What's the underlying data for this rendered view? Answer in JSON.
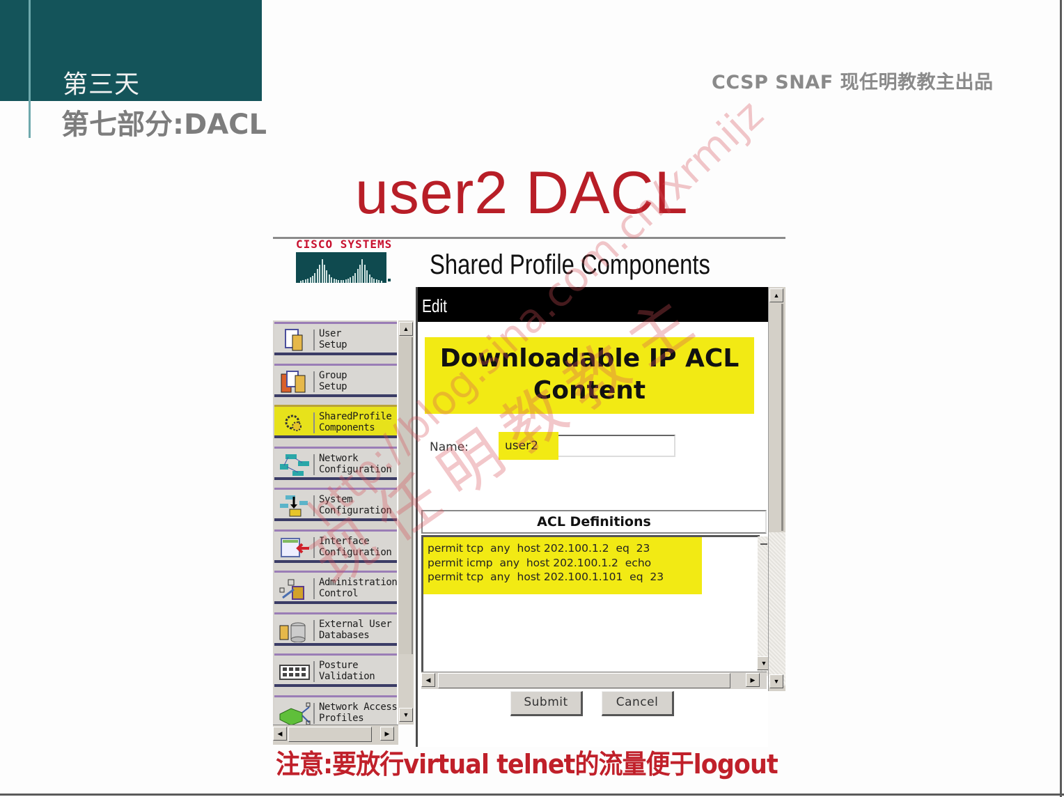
{
  "slide": {
    "day_label": "第三天",
    "part_label": "第七部分:DACL",
    "brand": "CCSP SNAF  现任明教教主出品",
    "title": "user2 DACL",
    "note": "注意:要放行virtual telnet的流量便于logout",
    "colors": {
      "teal": "#14545a",
      "title_red": "#b81e27",
      "highlight_yellow": "#f2ea14"
    }
  },
  "acs": {
    "vendor_text": "CISCO SYSTEMS",
    "page_title": "Shared Profile Components",
    "nav": {
      "items": [
        {
          "label": "User\nSetup",
          "icon": "user-setup-icon",
          "active": false
        },
        {
          "label": "Group\nSetup",
          "icon": "group-setup-icon",
          "active": false
        },
        {
          "label": "SharedProfile\nComponents",
          "icon": "shared-profile-icon",
          "active": true
        },
        {
          "label": "Network\nConfiguration",
          "icon": "network-config-icon",
          "active": false
        },
        {
          "label": "System\nConfiguration",
          "icon": "system-config-icon",
          "active": false
        },
        {
          "label": "Interface\nConfiguration",
          "icon": "interface-config-icon",
          "active": false
        },
        {
          "label": "Administration\nControl",
          "icon": "admin-control-icon",
          "active": false
        },
        {
          "label": "External User\nDatabases",
          "icon": "external-db-icon",
          "active": false
        },
        {
          "label": "Posture\nValidation",
          "icon": "posture-icon",
          "active": false
        },
        {
          "label": "Network Access\nProfiles",
          "icon": "nap-icon",
          "active": false
        }
      ]
    },
    "edit": {
      "bar_label": "Edit",
      "heading_line1": "Downloadable IP ACL",
      "heading_line2": "Content",
      "name_label": "Name:",
      "name_value": "user2",
      "acl_header": "ACL Definitions",
      "acl_lines": [
        "permit tcp  any  host 202.100.1.2  eq  23",
        "permit icmp  any  host 202.100.1.2  echo",
        "permit tcp  any  host 202.100.1.101  eq  23"
      ],
      "submit_label": "Submit",
      "cancel_label": "Cancel"
    },
    "scroll_glyphs": {
      "up": "▲",
      "down": "▼",
      "left": "◀",
      "right": "▶"
    }
  },
  "watermark": {
    "url": "http://blog.sina.com.cn/xrmijz",
    "name": "现任明教教主"
  }
}
